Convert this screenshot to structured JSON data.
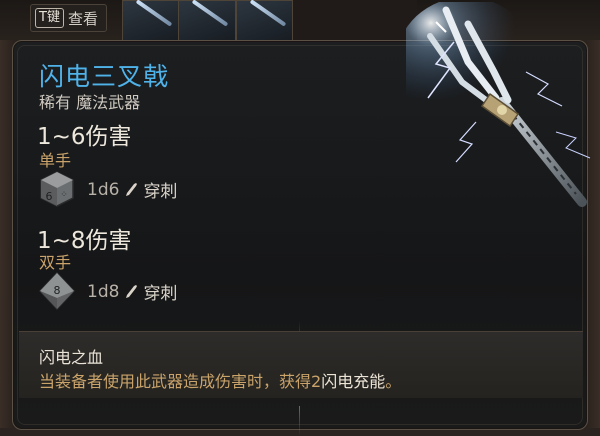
{
  "hotbar": {
    "key": "T键",
    "action": "查看"
  },
  "item": {
    "name": "闪电三叉戟",
    "rarity_type": "稀有 魔法武器",
    "name_color": "#4fb3ea"
  },
  "modes": [
    {
      "damage_range": "1~6伤害",
      "hand": "单手",
      "die_face": "6",
      "dice": "1d6",
      "damage_type": "穿刺"
    },
    {
      "damage_range": "1~8伤害",
      "hand": "双手",
      "die_face": "8",
      "dice": "1d8",
      "damage_type": "穿刺"
    }
  ],
  "effect": {
    "title": "闪电之血",
    "desc_before": "当装备者使用此武器造成伤害时，获得2",
    "desc_highlight": "闪电充能",
    "desc_after": "。"
  },
  "colors": {
    "accent_gold": "#c9a36a",
    "text_light": "#ede7dc"
  }
}
